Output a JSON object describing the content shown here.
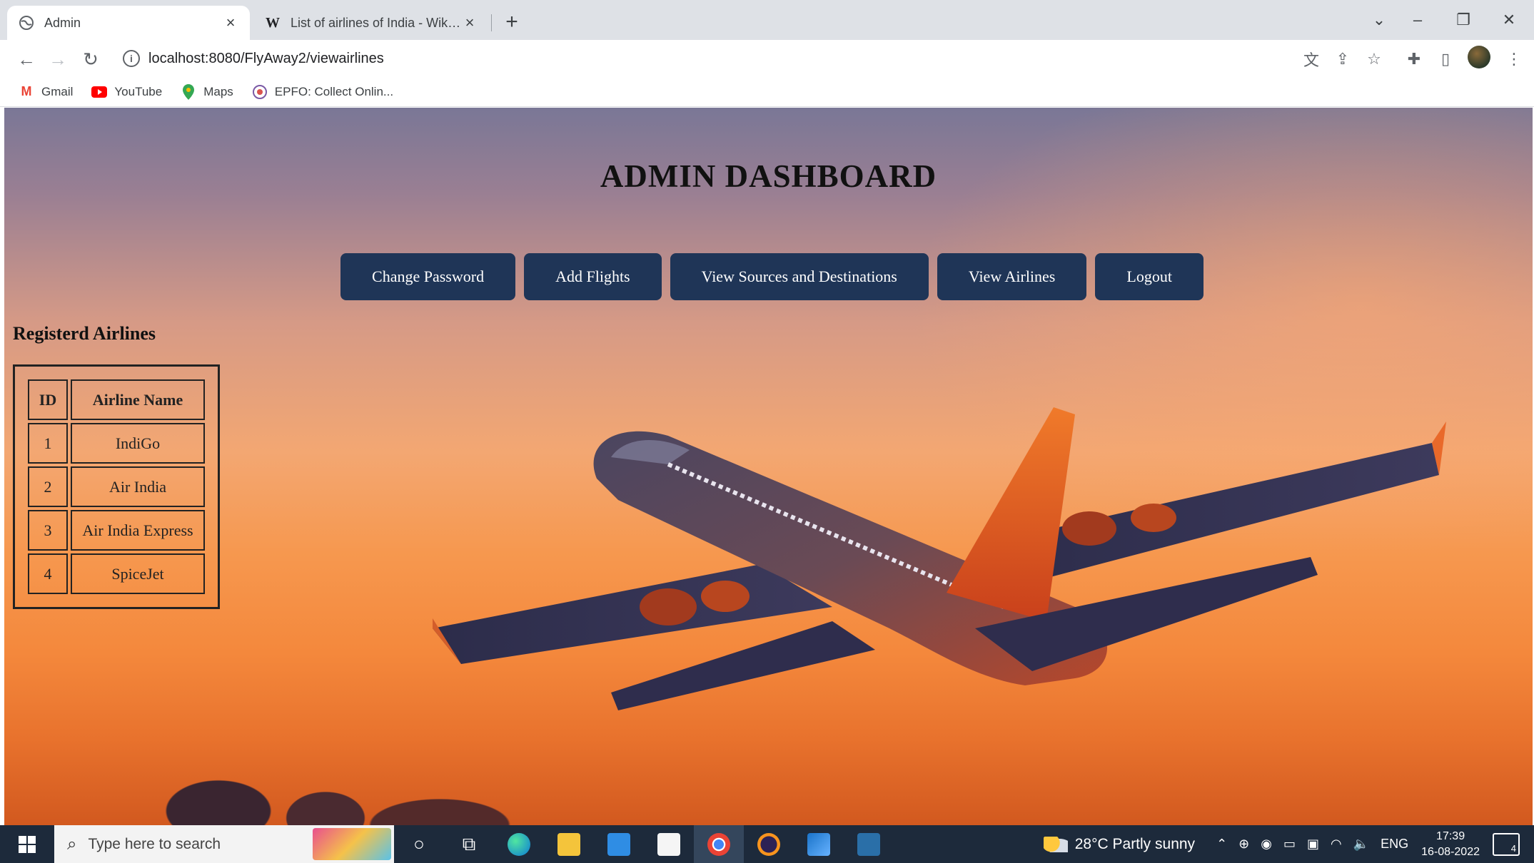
{
  "browser": {
    "tabs": [
      {
        "title": "Admin",
        "favicon": "globe-icon",
        "active": true
      },
      {
        "title": "List of airlines of India - Wikipedia",
        "favicon": "wikipedia-icon",
        "active": false
      }
    ],
    "url": "localhost:8080/FlyAway2/viewairlines",
    "bookmarks": [
      {
        "label": "Gmail",
        "icon": "gmail-icon",
        "color": "#ea4335"
      },
      {
        "label": "YouTube",
        "icon": "youtube-icon",
        "color": "#ff0000"
      },
      {
        "label": "Maps",
        "icon": "maps-icon",
        "color": "#34a853"
      },
      {
        "label": "EPFO: Collect Onlin...",
        "icon": "epfo-icon",
        "color": "#7b5aa6"
      }
    ]
  },
  "page": {
    "title": "ADMIN DASHBOARD",
    "nav": [
      {
        "label": "Change Password"
      },
      {
        "label": "Add Flights"
      },
      {
        "label": "View Sources and Destinations"
      },
      {
        "label": "View Airlines"
      },
      {
        "label": "Logout"
      }
    ],
    "section_title": "Registerd Airlines",
    "table": {
      "headers": [
        "ID",
        "Airline Name"
      ],
      "rows": [
        [
          "1",
          "IndiGo"
        ],
        [
          "2",
          "Air India"
        ],
        [
          "3",
          "Air India Express"
        ],
        [
          "4",
          "SpiceJet"
        ]
      ]
    },
    "colors": {
      "button_bg": "#1f3557",
      "button_text": "#ffffff"
    }
  },
  "taskbar": {
    "search_placeholder": "Type here to search",
    "weather": "28°C  Partly sunny",
    "language": "ENG",
    "time": "17:39",
    "date": "16-08-2022",
    "notification_count": "4"
  }
}
